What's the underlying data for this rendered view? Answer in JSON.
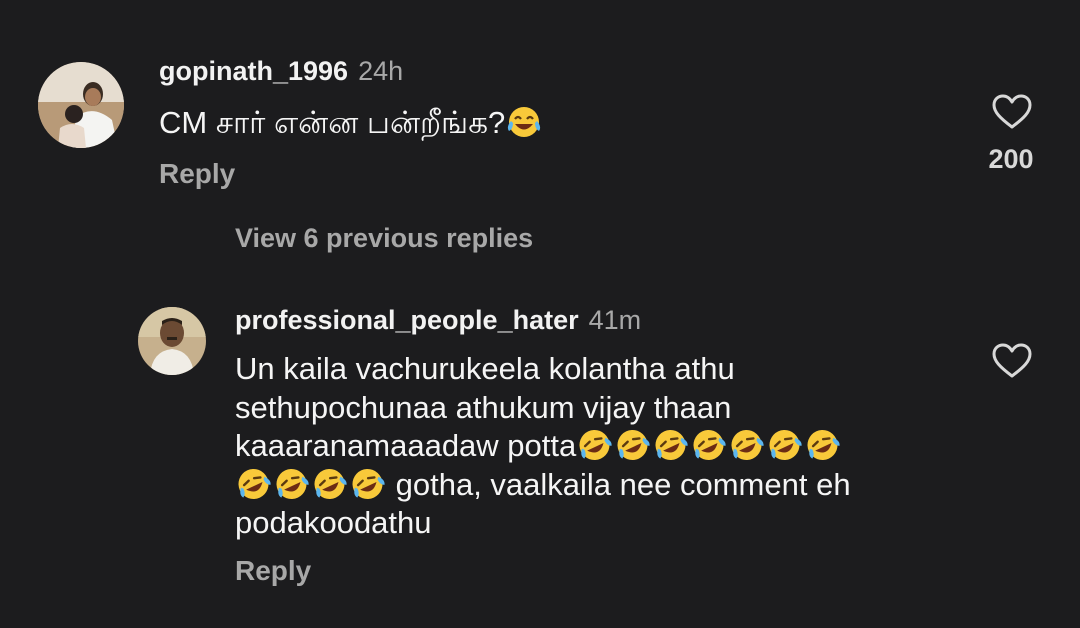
{
  "comments": [
    {
      "username": "gopinath_1996",
      "time": "24h",
      "text": "CM சார் என்ன பன்றீங்க?",
      "text_emoji": "😂",
      "reply_label": "Reply",
      "like_count": "200",
      "like_icon": "heart-outline-icon"
    },
    {
      "username": "professional_people_hater",
      "time": "41m",
      "text_line1": "Un kaila vachurukeela kolantha athu",
      "text_line2": "sethupochunaa athukum vijay thaan",
      "text_line3": "kaaaranamaaadaw potta",
      "text_line3_emoji": "🤣🤣🤣🤣🤣🤣🤣",
      "text_line4_emoji": "🤣🤣🤣🤣",
      "text_line4": " gotha, vaalkaila nee comment eh",
      "text_line5": "podakoodathu",
      "reply_label": "Reply",
      "like_icon": "heart-outline-icon"
    }
  ],
  "thread": {
    "view_replies_label": "View 6 previous replies"
  },
  "colors": {
    "background": "#1c1c1e",
    "primary_text": "#f5f5f5",
    "secondary_text": "#a8a8a8"
  }
}
